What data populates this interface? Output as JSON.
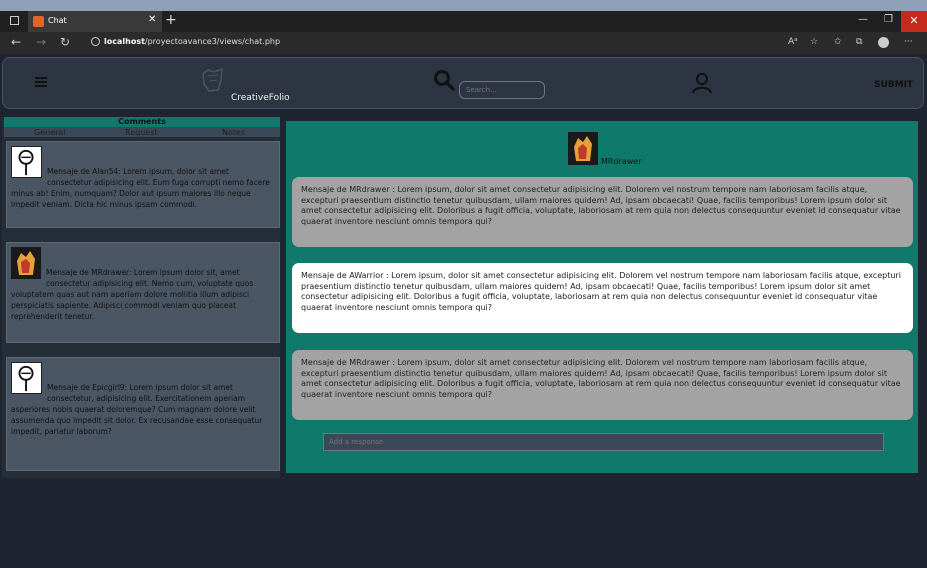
{
  "browser": {
    "tab_title": "Chat",
    "url_host": "localhost",
    "url_path": "/proyectoavance3/views/chat.php",
    "new_tab": "+",
    "close": "✕"
  },
  "header": {
    "logo_text": "CreativeFolio",
    "search_placeholder": "Search...",
    "submit_label": "SUBMIT"
  },
  "sidebar": {
    "title": "Comments",
    "tabs": [
      "General",
      "Request",
      "Notes"
    ],
    "cards": [
      {
        "avatar": "stickman-icon",
        "text": "Mensaje de Alan54: Lorem ipsum, dolor sit amet consectetur adipisicing elit. Eum fuga corrupti nemo facere minus ab! Enim, numquam? Dolor aut ipsum maiores illo neque impedit veniam. Dicta hic minus ipsam commodi."
      },
      {
        "avatar": "fire-logo-icon",
        "text": "Mensaje de MRdrawer: Lorem ipsum dolor sit, amet consectetur adipisicing elit. Nemo cum, voluptate quos voluptatem quas aut nam aperiam dolore mollitia illum adipisci perspiciatis sapiente. Adipisci commodi veniam quo placeat reprehenderit tenetur."
      },
      {
        "avatar": "stickman-icon",
        "text": "Mensaje de Epicgirl9: Lorem ipsum dolor sit amet consectetur, adipisicing elit. Exercitationem aperiam asperiores nobis quaerat doloremque? Cum magnam dolore velit assumenda quo impedit sit dolor. Ex recusandae esse consequatur impedit, pariatur laborum?"
      }
    ]
  },
  "chat": {
    "user_name": "MRdrawer",
    "messages": [
      {
        "style": "grey",
        "text": "Mensaje de MRdrawer : Lorem ipsum, dolor sit amet consectetur adipisicing elit. Dolorem vel nostrum tempore nam laboriosam facilis atque, excepturi praesentium distinctio tenetur quibusdam, ullam maiores quidem! Ad, ipsam obcaecati! Quae, facilis temporibus! Lorem ipsum dolor sit amet consectetur adipisicing elit. Doloribus a fugit officia, voluptate, laboriosam at rem quia non delectus consequuntur eveniet id consequatur vitae quaerat inventore nesciunt omnis tempora qui?"
      },
      {
        "style": "white",
        "text": "Mensaje de AWarrior : Lorem ipsum, dolor sit amet consectetur adipisicing elit. Dolorem vel nostrum tempore nam laboriosam facilis atque, excepturi praesentium distinctio tenetur quibusdam, ullam maiores quidem! Ad, ipsam obcaecati! Quae, facilis temporibus! Lorem ipsum dolor sit amet consectetur adipisicing elit. Doloribus a fugit officia, voluptate, laboriosam at rem quia non delectus consequuntur eveniet id consequatur vitae quaerat inventore nesciunt omnis tempora qui?"
      },
      {
        "style": "grey",
        "text": "Mensaje de MRdrawer : Lorem ipsum, dolor sit amet consectetur adipisicing elit. Dolorem vel nostrum tempore nam laboriosam facilis atque, excepturi praesentium distinctio tenetur quibusdam, ullam maiores quidem! Ad, ipsam obcaecati! Quae, facilis temporibus! Lorem ipsum dolor sit amet consectetur adipisicing elit. Doloribus a fugit officia, voluptate, laboriosam at rem quia non delectus consequuntur eveniet id consequatur vitae quaerat inventore nesciunt omnis tempora qui?"
      }
    ],
    "reply_placeholder": "Add a response"
  },
  "colors": {
    "teal": "#0f7a6c",
    "page_bg": "#1e2530",
    "card_bg": "#4b5664"
  }
}
